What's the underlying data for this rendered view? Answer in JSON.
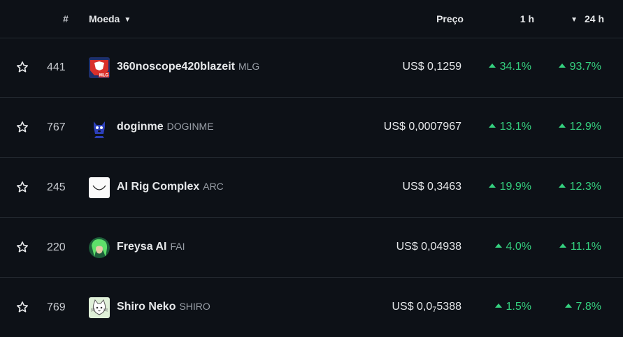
{
  "header": {
    "rank_label": "#",
    "coin_label": "Moeda",
    "coin_caret": "▼",
    "price_label": "Preço",
    "h1_label": "1 h",
    "h24_caret": "▼",
    "h24_label": "24 h"
  },
  "rows": [
    {
      "rank": "441",
      "name": "360noscope420blazeit",
      "symbol": "MLG",
      "price": "US$ 0,1259",
      "h1": "34.1%",
      "h24": "93.7%",
      "logo_text": "MLG",
      "logo_icon": "mlg-logo-icon"
    },
    {
      "rank": "767",
      "name": "doginme",
      "symbol": "DOGINME",
      "price": "US$ 0,0007967",
      "h1": "13.1%",
      "h24": "12.9%",
      "logo_icon": "doginme-logo-icon"
    },
    {
      "rank": "245",
      "name": "AI Rig Complex",
      "symbol": "ARC",
      "price": "US$ 0,3463",
      "h1": "19.9%",
      "h24": "12.3%",
      "logo_icon": "arc-logo-icon"
    },
    {
      "rank": "220",
      "name": "Freysa AI",
      "symbol": "FAI",
      "price": "US$ 0,04938",
      "h1": "4.0%",
      "h24": "11.1%",
      "logo_icon": "freysa-logo-icon"
    },
    {
      "rank": "769",
      "name": "Shiro Neko",
      "symbol": "SHIRO",
      "price_prefix": "US$ 0,0",
      "price_sub": "7",
      "price_suffix": "5388",
      "h1": "1.5%",
      "h24": "7.8%",
      "logo_icon": "shiro-neko-logo-icon"
    }
  ],
  "colors": {
    "background": "#0d1117",
    "positive": "#35d07f",
    "divider": "#242a31"
  }
}
